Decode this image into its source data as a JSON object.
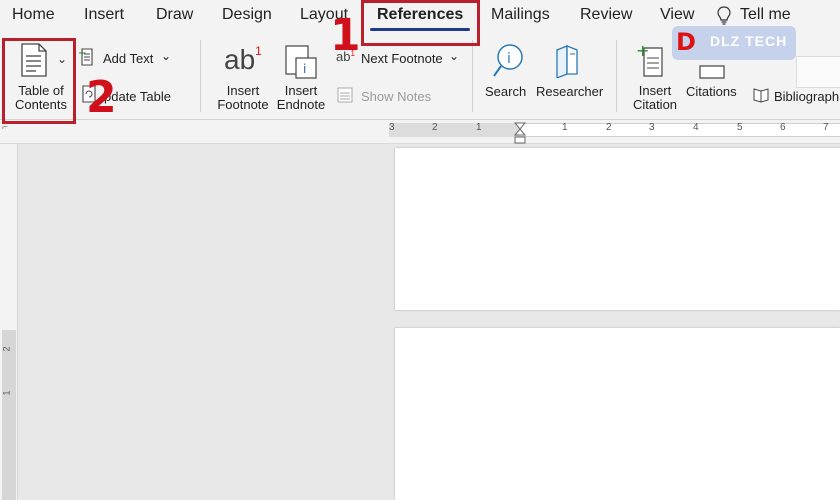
{
  "tabs": [
    {
      "label": "Home"
    },
    {
      "label": "Insert"
    },
    {
      "label": "Draw"
    },
    {
      "label": "Design"
    },
    {
      "label": "Layout"
    },
    {
      "label": "References"
    },
    {
      "label": "Mailings"
    },
    {
      "label": "Review"
    },
    {
      "label": "View"
    },
    {
      "label": "Tell me"
    }
  ],
  "active_tab": "References",
  "ribbon": {
    "toc_line1": "Table of",
    "toc_line2": "Contents",
    "add_text": "Add Text",
    "update_table": "Update Table",
    "update_table_visible": "pdate Table",
    "insert_footnote_line1": "Insert",
    "insert_footnote_line2": "Footnote",
    "insert_endnote_line1": "Insert",
    "insert_endnote_line2": "Endnote",
    "next_footnote": "Next Footnote",
    "show_notes": "Show Notes",
    "search": "Search",
    "researcher": "Researcher",
    "insert_citation_line1": "Insert",
    "insert_citation_line2": "Citation",
    "citations": "Citations",
    "bibliography": "Bibliograph"
  },
  "annotations": {
    "step1": "1",
    "step2": "2",
    "highlight_color": "#b8202b",
    "step_color": "#d0101a"
  },
  "watermark": {
    "mark": "D",
    "text": "DLZ TECH"
  },
  "ruler": {
    "labels": [
      "3",
      "2",
      "1",
      "1",
      "1",
      "2",
      "3",
      "4",
      "5",
      "6",
      "7"
    ]
  },
  "vruler": {
    "labels": [
      "2",
      "1"
    ]
  },
  "icons": {
    "toc": "document-list-icon",
    "add_text": "add-text-icon",
    "update_table": "refresh-table-icon",
    "insert_footnote": "footnote-ab-icon",
    "insert_endnote": "endnote-icon",
    "next_footnote": "next-footnote-icon",
    "show_notes": "show-notes-icon",
    "search": "search-icon",
    "researcher": "researcher-icon",
    "insert_citation": "citation-icon",
    "citations": "citations-icon",
    "bibliography": "bibliography-icon",
    "tell_me": "lightbulb-icon"
  }
}
